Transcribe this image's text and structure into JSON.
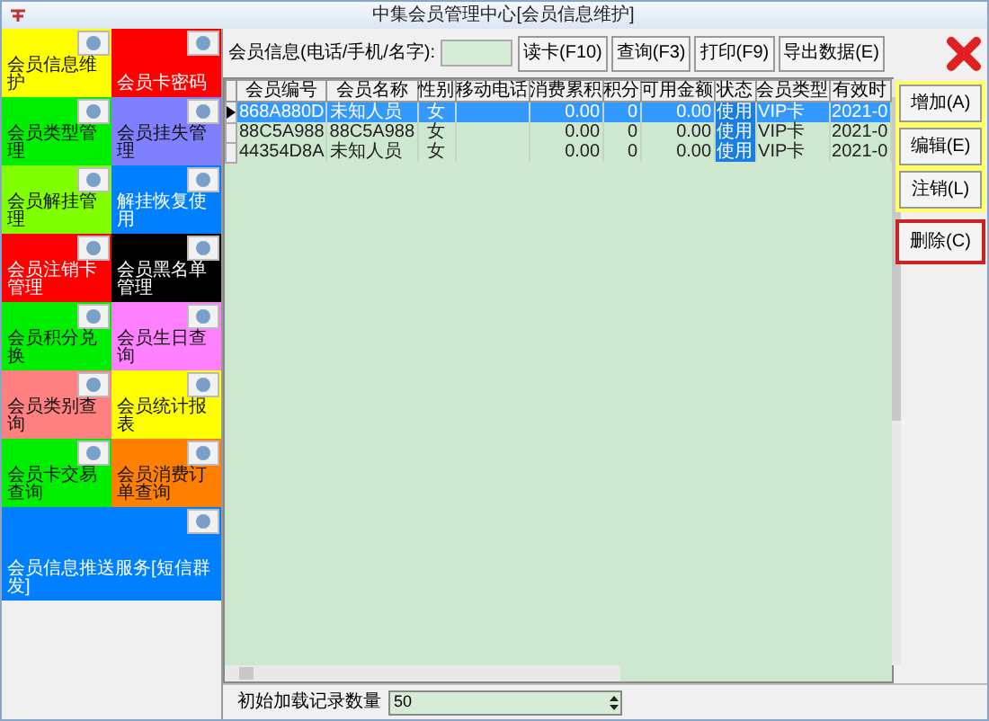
{
  "window": {
    "title": "中集会员管理中心[会员信息维护]"
  },
  "tiles": [
    {
      "label": "会员信息维护",
      "color": "#ffff00"
    },
    {
      "label": "会员卡密码",
      "color": "#ff0000"
    },
    {
      "label": "会员类型管理",
      "color": "#00ee00"
    },
    {
      "label": "会员挂失管理",
      "color": "#8080ff"
    },
    {
      "label": "会员解挂管理",
      "color": "#80ff00"
    },
    {
      "label": "解挂恢复使用",
      "color": "#0080ff"
    },
    {
      "label": "会员注销卡管理",
      "color": "#ff0000"
    },
    {
      "label": "会员黑名单管理",
      "color": "#000000"
    },
    {
      "label": "会员积分兑换",
      "color": "#00ee00"
    },
    {
      "label": "会员生日查询",
      "color": "#ff80ff"
    },
    {
      "label": "会员类别查询",
      "color": "#ff8080"
    },
    {
      "label": "会员统计报表",
      "color": "#ffff00"
    },
    {
      "label": "会员卡交易查询",
      "color": "#00ee00"
    },
    {
      "label": "会员消费订单查询",
      "color": "#ff8000"
    },
    {
      "label": "会员信息推送服务[短信群发]",
      "color": "#0080ff"
    }
  ],
  "search": {
    "label": "会员信息(电话/手机/名字):"
  },
  "toolbar": [
    "读卡(F10)",
    "查询(F3)",
    "打印(F9)",
    "导出数据(E)"
  ],
  "table": {
    "columns": [
      "会员编号",
      "会员名称",
      "性别",
      "移动电话",
      "消费累积",
      "积分",
      "可用金额",
      "状态",
      "会员类型",
      "有效时"
    ],
    "rows": [
      {
        "selected": true,
        "cells": [
          "868A880D",
          "未知人员",
          "女",
          "",
          "0.00",
          "0",
          "0.00",
          "使用",
          "VIP卡",
          "2021-0"
        ]
      },
      {
        "selected": false,
        "cells": [
          "88C5A988",
          "88C5A988",
          "女",
          "",
          "0.00",
          "0",
          "0.00",
          "使用",
          "VIP卡",
          "2021-0"
        ]
      },
      {
        "selected": false,
        "cells": [
          "44354D8A",
          "未知人员",
          "女",
          "",
          "0.00",
          "0",
          "0.00",
          "使用",
          "VIP卡",
          "2021-0"
        ]
      }
    ]
  },
  "side_buttons": [
    {
      "label": "增加(A)",
      "kind": "normal"
    },
    {
      "label": "编辑(E)",
      "kind": "normal"
    },
    {
      "label": "注销(L)",
      "kind": "normal"
    },
    {
      "label": "删除(C)",
      "kind": "danger"
    }
  ],
  "footer": {
    "label": "初始加载记录数量",
    "value": "50"
  }
}
